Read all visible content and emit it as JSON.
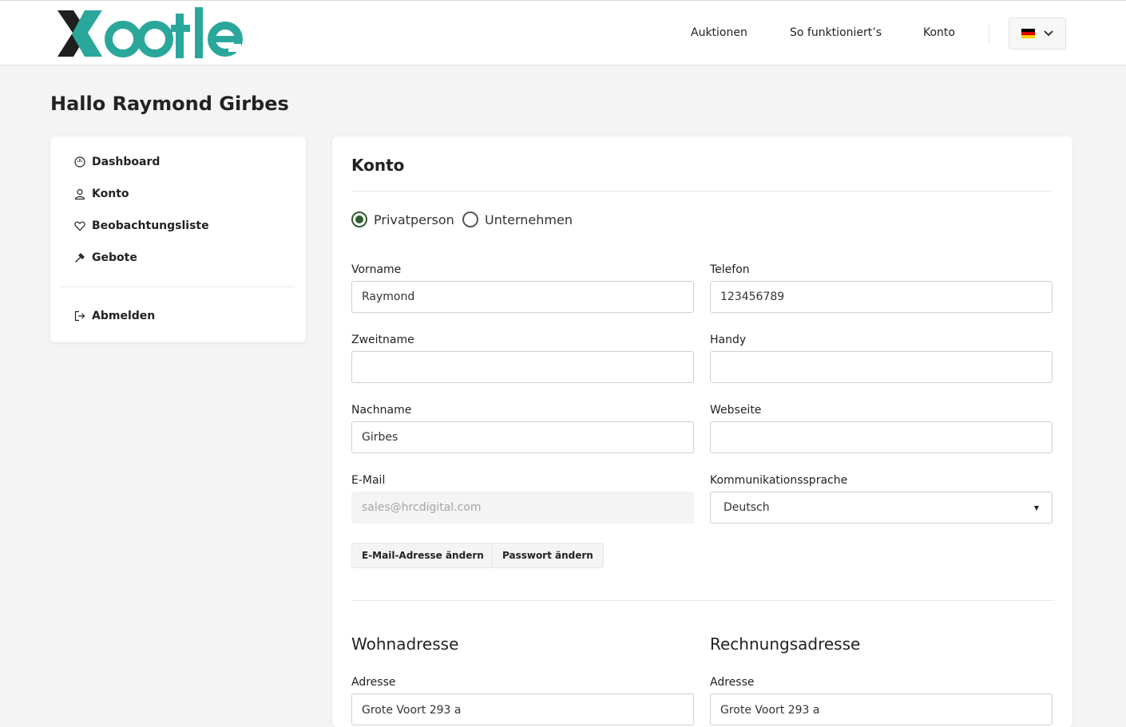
{
  "header": {
    "logo_text": "Xootle",
    "nav": [
      "Auktionen",
      "So funktioniert’s",
      "Konto"
    ],
    "language_flag": "german-flag-icon"
  },
  "greeting": "Hallo Raymond Girbes",
  "sidebar": {
    "items": [
      {
        "label": "Dashboard",
        "icon": "dashboard-icon"
      },
      {
        "label": "Konto",
        "icon": "user-icon"
      },
      {
        "label": "Beobachtungsliste",
        "icon": "heart-icon"
      },
      {
        "label": "Gebote",
        "icon": "gavel-icon"
      }
    ],
    "logout": {
      "label": "Abmelden",
      "icon": "logout-icon"
    }
  },
  "account": {
    "title": "Konto",
    "type_options": [
      {
        "label": "Privatperson",
        "checked": true
      },
      {
        "label": "Unternehmen",
        "checked": false
      }
    ],
    "fields": {
      "vorname": {
        "label": "Vorname",
        "value": "Raymond"
      },
      "zweitname": {
        "label": "Zweitname",
        "value": ""
      },
      "nachname": {
        "label": "Nachname",
        "value": "Girbes"
      },
      "email": {
        "label": "E-Mail",
        "value": "sales@hrcdigital.com"
      },
      "telefon": {
        "label": "Telefon",
        "value": "123456789"
      },
      "handy": {
        "label": "Handy",
        "value": ""
      },
      "webseite": {
        "label": "Webseite",
        "value": ""
      },
      "sprache": {
        "label": "Kommunikationssprache",
        "value": "Deutsch"
      }
    },
    "buttons": {
      "change_email": "E-Mail-Adresse ändern",
      "change_password": "Passwort ändern"
    }
  },
  "addresses": {
    "home": {
      "title": "Wohnadresse",
      "address_label": "Adresse",
      "address_value": "Grote Voort 293 a"
    },
    "billing": {
      "title": "Rechnungsadresse",
      "address_label": "Adresse",
      "address_value": "Grote Voort 293 a"
    }
  },
  "colors": {
    "brand_teal": "#2aa79b",
    "brand_dark": "#1f1f1f",
    "radio_checked": "#2f5d2f"
  }
}
